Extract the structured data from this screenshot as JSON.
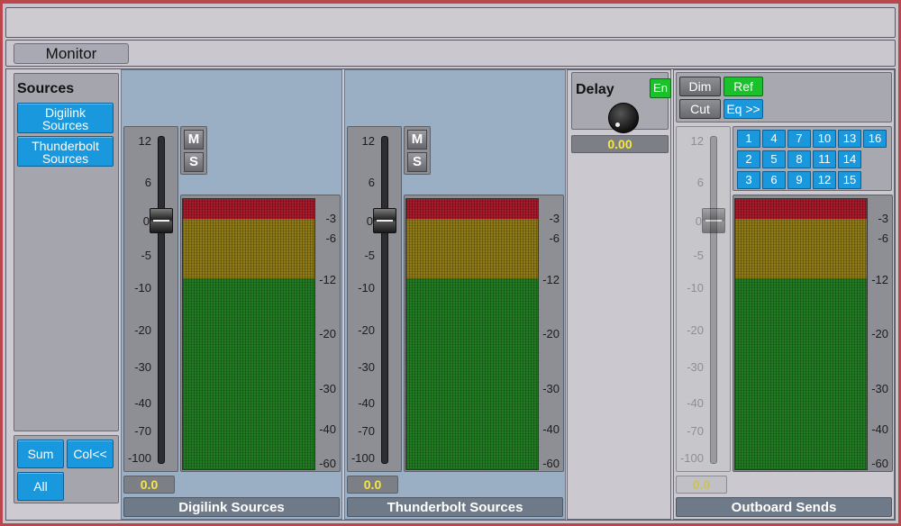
{
  "tabs": {
    "monitor": "Monitor"
  },
  "sources": {
    "title": "Sources",
    "items": [
      {
        "line1": "Digilink",
        "line2": "Sources"
      },
      {
        "line1": "Thunderbolt",
        "line2": "Sources"
      }
    ],
    "buttons": {
      "sum": "Sum",
      "col": "Col<<",
      "all": "All"
    }
  },
  "fader_scale": [
    "12",
    "6",
    "0",
    "-5",
    "-10",
    "-20",
    "-30",
    "-40",
    "-70",
    "-100"
  ],
  "meter_scale": [
    "-3",
    "-6",
    "-12",
    "-20",
    "-30",
    "-40",
    "-60"
  ],
  "strips": [
    {
      "name": "Digilink Sources",
      "value": "0.0",
      "mute": "M",
      "solo": "S"
    },
    {
      "name": "Thunderbolt Sources",
      "value": "0.0",
      "mute": "M",
      "solo": "S"
    }
  ],
  "delay": {
    "title": "Delay",
    "enable": "En",
    "value": "0.00"
  },
  "outboard": {
    "name": "Outboard Sends",
    "value": "0.0",
    "dim": "Dim",
    "ref": "Ref",
    "cut": "Cut",
    "eq": "Eq >>",
    "numbers": [
      "1",
      "4",
      "7",
      "10",
      "13",
      "16",
      "2",
      "5",
      "8",
      "11",
      "14",
      "3",
      "6",
      "9",
      "12",
      "15"
    ]
  },
  "colors": {
    "accent_blue": "#1a98de",
    "accent_green": "#1bc12a",
    "value_yellow": "#f5e93b",
    "window_border": "#b8464c"
  }
}
